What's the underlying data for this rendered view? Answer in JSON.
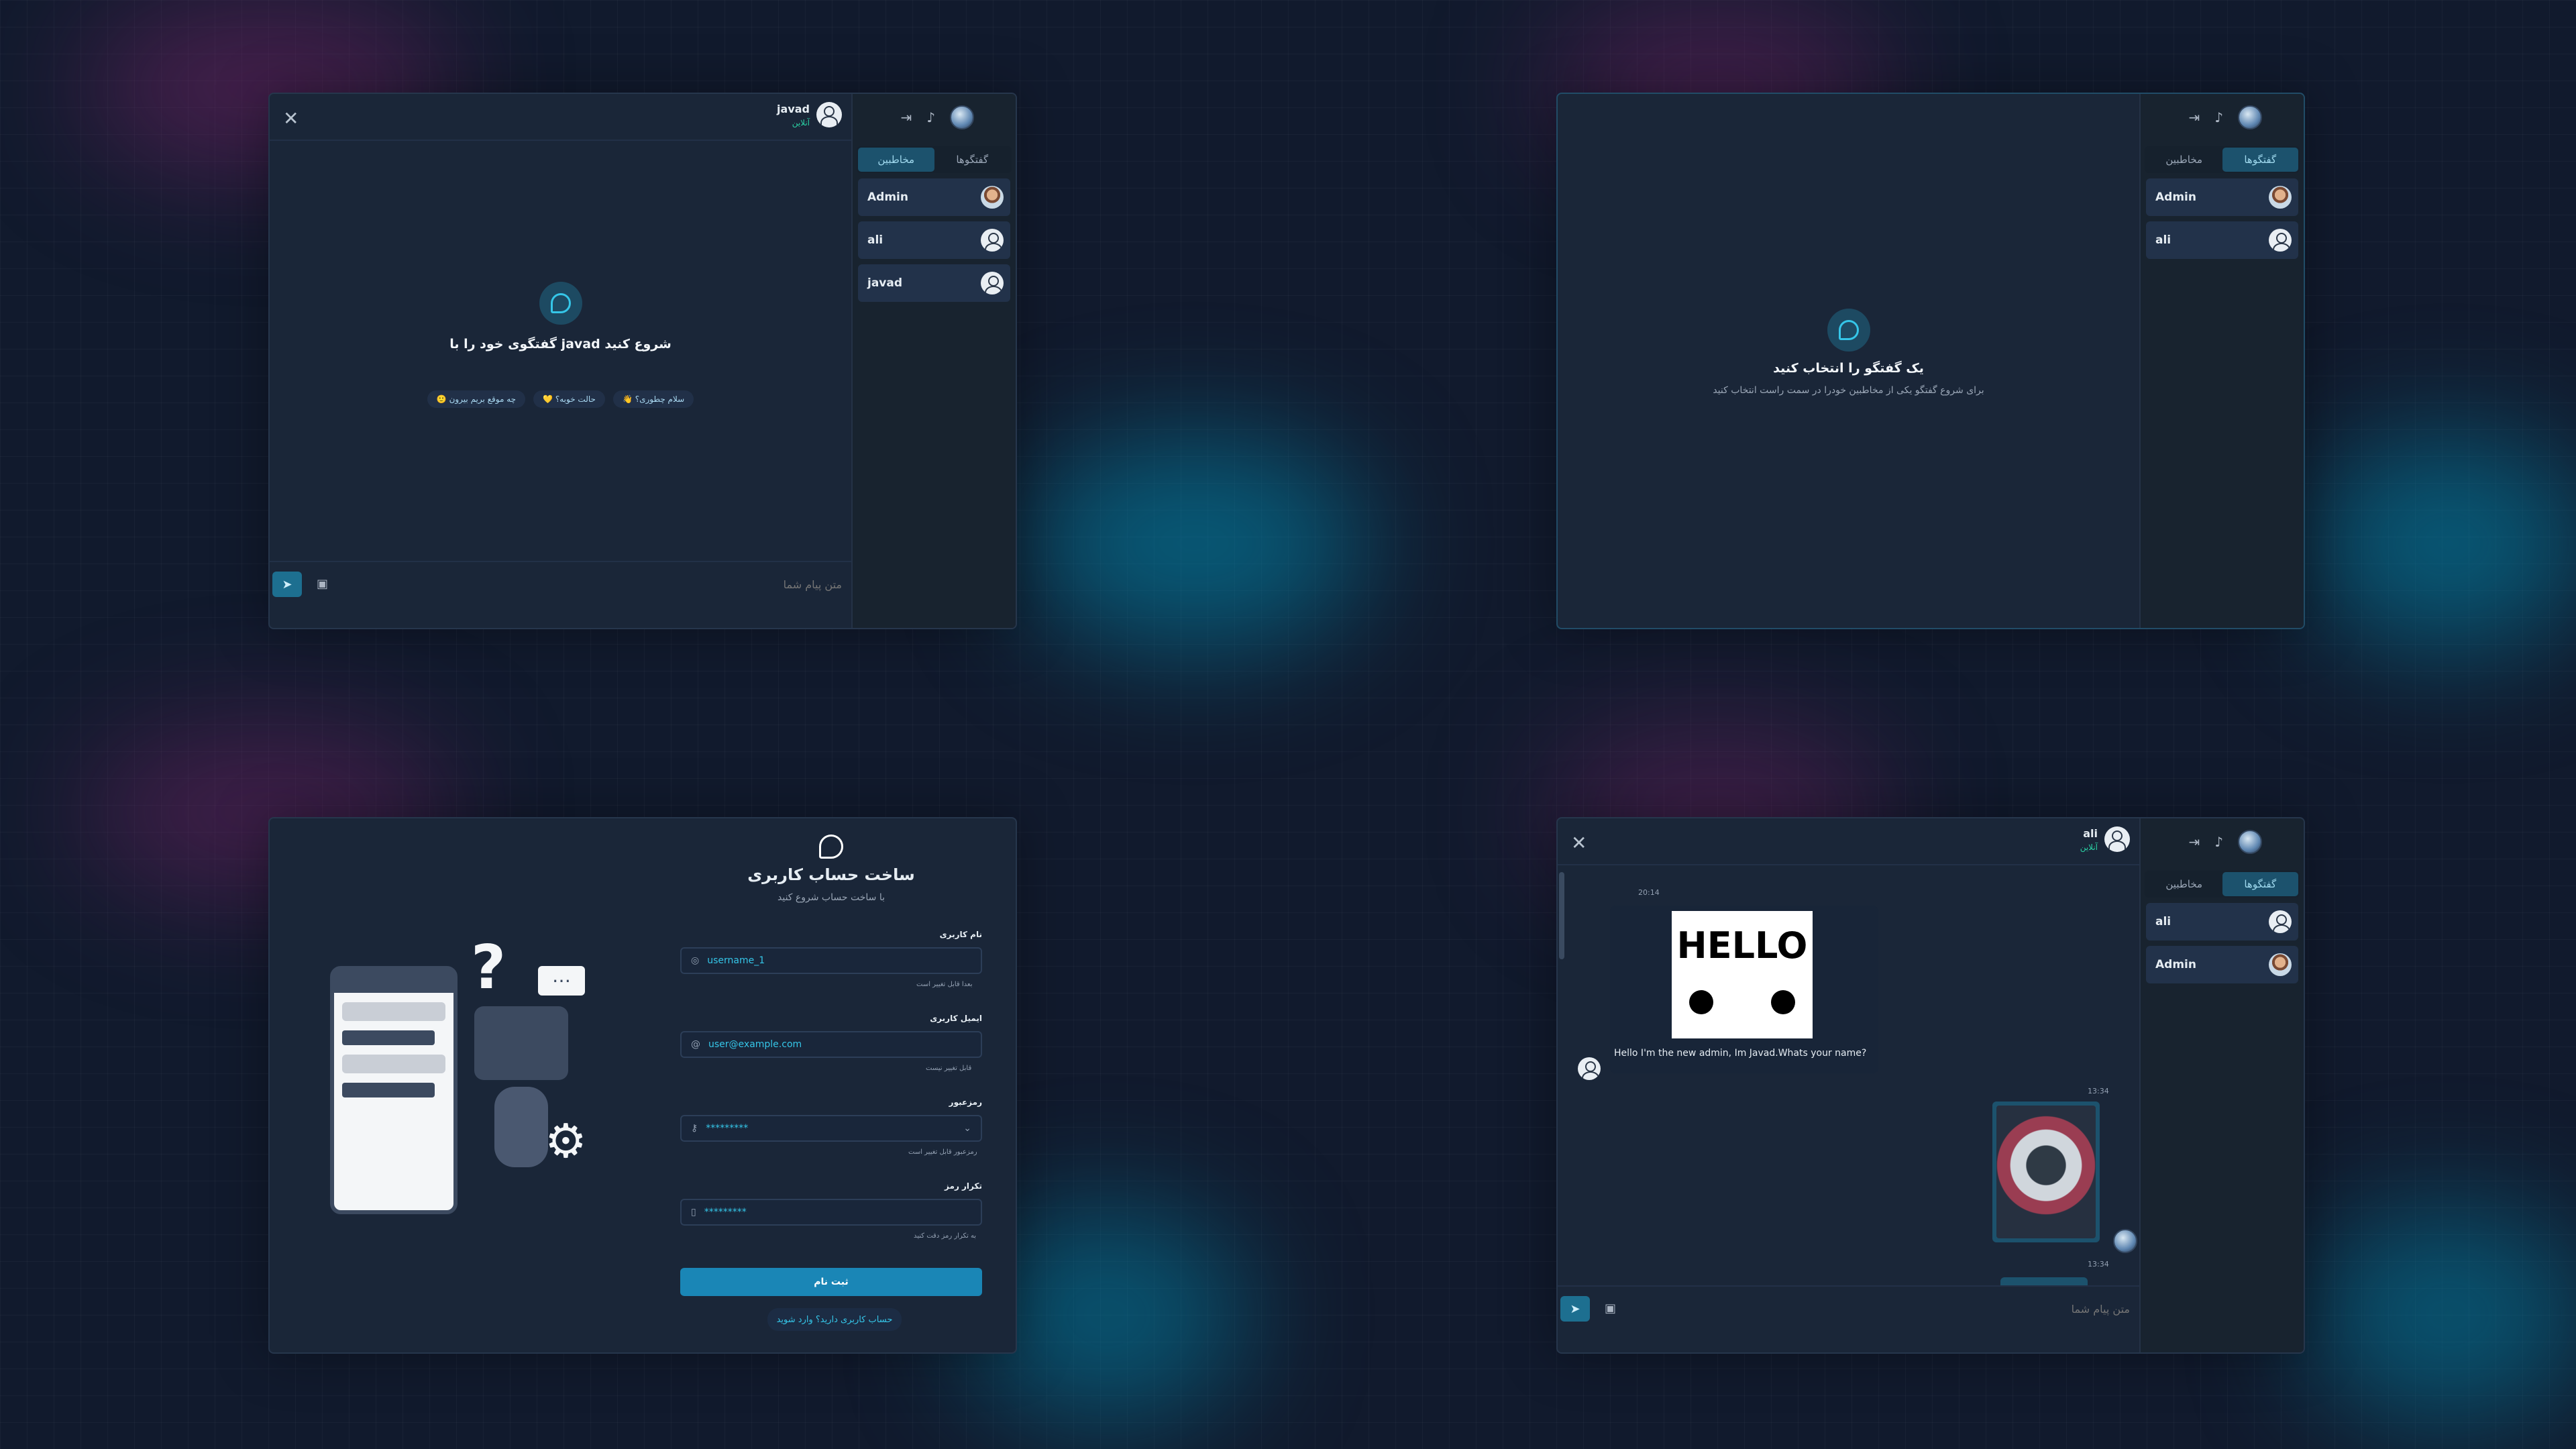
{
  "panels": {
    "p1": {
      "tabs": [
        "گفتگوها",
        "مخاطبین"
      ],
      "contacts": [
        {
          "name": "Admin"
        },
        {
          "name": "ali"
        },
        {
          "name": "javad"
        }
      ],
      "header": {
        "name": "javad",
        "status": "آنلاین"
      },
      "empty_title": "گفتگوی خود را با javad شروع کنید",
      "chips": [
        "👋 سلام چطوری؟",
        "💛 حالت خوبه؟",
        "🙂 چه موقع بریم بیرون"
      ],
      "input_placeholder": "متن پیام شما"
    },
    "p2": {
      "tabs": [
        "گفتگوها",
        "مخاطبین"
      ],
      "contacts": [
        {
          "name": "Admin"
        },
        {
          "name": "ali"
        }
      ],
      "empty_title": "یک گفتگو را انتخاب کنید",
      "empty_sub": "برای شروع گفتگو یکی از مخاطبین خودرا در سمت راست انتخاب کنید"
    },
    "p3": {
      "title": "ساخت حساب کاربری",
      "subtitle": "با ساخت حساب شروع کنید",
      "fields": [
        {
          "label": "نام کاربری",
          "value": "username_1",
          "hint": "بعدا قابل تغییر است"
        },
        {
          "label": "ایمیل کاربری",
          "value": "user@example.com",
          "hint": "قابل تغییر نیست"
        },
        {
          "label": "رمزعبور",
          "value": "*********",
          "hint": "رمزعبور قابل تغییر است"
        },
        {
          "label": "تکرار رمز",
          "value": "*********",
          "hint": "به تکرار رمز دقت کنید"
        }
      ],
      "submit_label": "ثبت نام",
      "login_link": "حساب کاربری دارید؟ وارد شوید"
    },
    "p4": {
      "tabs": [
        "گفتگوها",
        "مخاطبین"
      ],
      "contacts": [
        {
          "name": "ali"
        },
        {
          "name": "Admin"
        }
      ],
      "header": {
        "name": "ali",
        "status": "آنلاین"
      },
      "messages": [
        {
          "time": "20:14",
          "image_text": "HELLO",
          "text": "Hello I'm the new admin, Im Javad.Whats your name?"
        },
        {
          "time": "13:34"
        },
        {
          "time": "13:34"
        }
      ],
      "input_placeholder": "متن پیام شما"
    }
  }
}
